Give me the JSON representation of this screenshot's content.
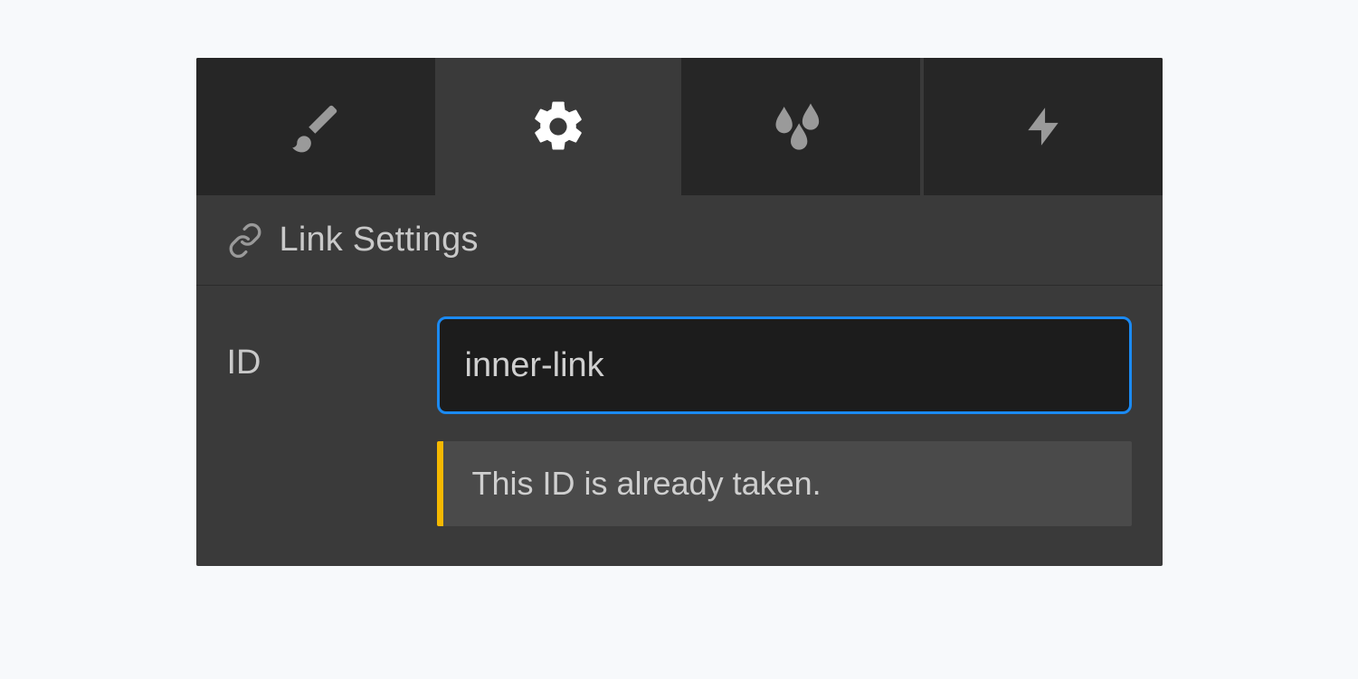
{
  "tabs": {
    "brush": "brush",
    "settings": "settings",
    "effects": "effects",
    "interactions": "interactions",
    "active_index": 1
  },
  "section": {
    "title": "Link Settings"
  },
  "field": {
    "id_label": "ID",
    "id_value": "inner-link",
    "warning_text": "This ID is already taken."
  },
  "colors": {
    "focus_border": "#1b8af3",
    "warning_accent": "#f5b800"
  }
}
